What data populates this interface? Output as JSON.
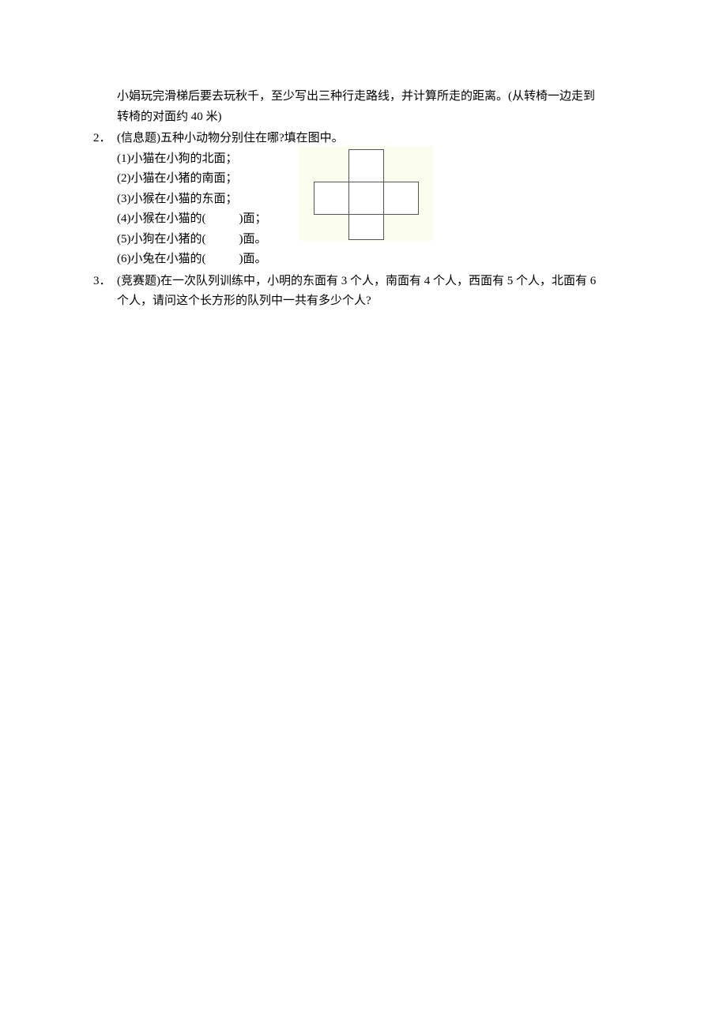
{
  "q1_cont": {
    "line1": "小娟玩完滑梯后要去玩秋千，至少写出三种行走路线，并计算所走的距离。(从转椅一边走到",
    "line2": "转椅的对面约 40 米)"
  },
  "q2": {
    "num": "2．",
    "title": "(信息题)五种小动物分别住在哪?填在图中。",
    "s1": "(1)小猫在小狗的北面；",
    "s2": "(2)小猫在小猪的南面；",
    "s3": "(3)小猴在小猫的东面；",
    "s4_a": "(4)小猴在小猫的(",
    "s4_b": ")面；",
    "s5_a": "(5)小狗在小猪的(",
    "s5_b": ")面。",
    "s6_a": "(6)小兔在小猫的(",
    "s6_b": ")面。"
  },
  "q3": {
    "num": "3．",
    "line1": "(竞赛题)在一次队列训练中，小明的东面有 3 个人，南面有 4 个人，西面有 5 个人，北面有 6",
    "line2": "个人，请问这个长方形的队列中一共有多少个人?"
  }
}
